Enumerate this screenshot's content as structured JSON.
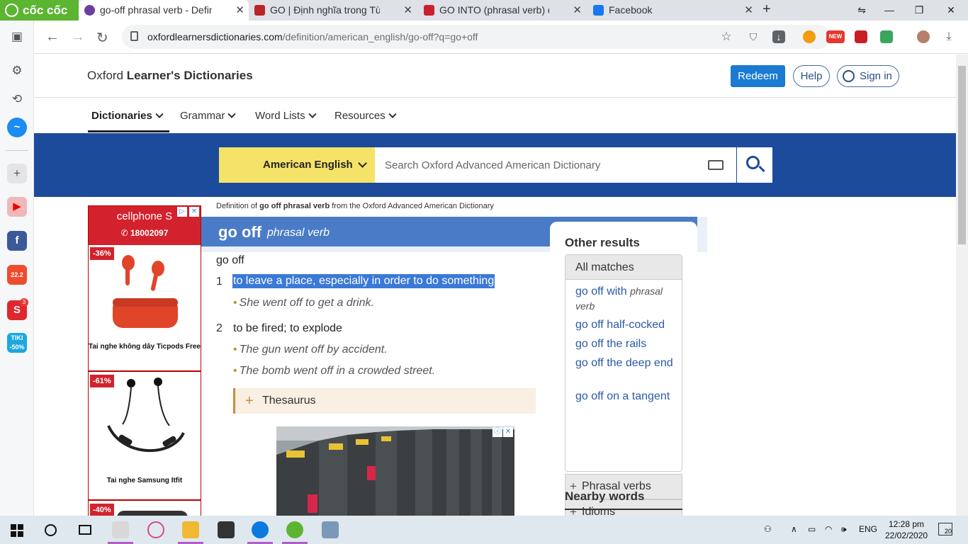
{
  "browser": {
    "brand": "cốc cốc",
    "tabs": [
      {
        "title": "go-off phrasal verb - Definitio",
        "active": true
      },
      {
        "title": "GO | Định nghĩa trong Từ điển"
      },
      {
        "title": "GO INTO (phrasal verb) defini"
      },
      {
        "title": "Facebook"
      }
    ],
    "new_tab": "+",
    "url_host": "oxfordlearnersdictionaries.com",
    "url_path": "/definition/american_english/go-off?q=go+off",
    "ext_new_badge": "NEW"
  },
  "sidebar": {
    "shopee_badge": "22.2",
    "notif_count": "3",
    "tiki_label": "TIKI",
    "tiki_discount": "-50%"
  },
  "site": {
    "title_prefix": "Oxford ",
    "title_bold": "Learner's Dictionaries",
    "redeem": "Redeem",
    "help": "Help",
    "sign_in": "Sign in",
    "menu": [
      "Dictionaries",
      "Grammar",
      "Word Lists",
      "Resources"
    ],
    "dictionary_select": "American English",
    "search_placeholder": "Search Oxford Advanced American Dictionary"
  },
  "ads": {
    "brand": "cellphone S",
    "phone": "18002097",
    "cards": [
      {
        "discount": "-36%",
        "name": "Tai nghe không dây Ticpods Free"
      },
      {
        "discount": "-61%",
        "name": "Tai nghe Samsung Itfit"
      },
      {
        "discount": "-40%",
        "name": ""
      }
    ]
  },
  "entry": {
    "crumb_pre": "Definition of ",
    "crumb_word": "go off phrasal verb",
    "crumb_post": " from the Oxford Advanced American Dictionary",
    "headword": "go off",
    "pos": "phrasal verb",
    "phrase": "go off",
    "senses": [
      {
        "num": "1",
        "def": "to leave a place, especially in order to do something",
        "examples": [
          "She went off to get a drink."
        ]
      },
      {
        "num": "2",
        "def": "to be fired; to explode",
        "examples": [
          "The gun went off by accident.",
          "The bomb went off in a crowded street."
        ]
      }
    ],
    "thesaurus": "Thesaurus"
  },
  "other_results": {
    "title": "Other results",
    "all_matches": "All matches",
    "matches": [
      {
        "text": "go off with",
        "pos": "phrasal verb"
      },
      {
        "text": "go off half-cocked"
      },
      {
        "text": "go off the rails"
      },
      {
        "text": "go off the deep end"
      },
      {
        "text": "go off on a tangent"
      }
    ],
    "phrasal_verbs": "Phrasal verbs",
    "idioms": "Idioms",
    "nearby": "Nearby words"
  },
  "taskbar": {
    "lang": "ENG",
    "time": "12:28 pm",
    "date": "22/02/2020",
    "notifications": "20"
  },
  "colors": {
    "oxford_blue": "#1c4b9c",
    "entry_blue": "#4a7bc7",
    "highlight": "#3b79d8",
    "dict_yellow": "#f4e368",
    "coccoc_green": "#5bb531"
  }
}
